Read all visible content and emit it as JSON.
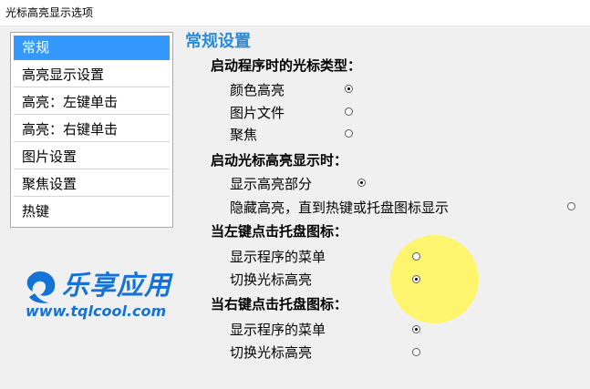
{
  "window": {
    "title": "光标高亮显示选项"
  },
  "sidebar": {
    "items": [
      {
        "label": "常规",
        "selected": true
      },
      {
        "label": "高亮显示设置",
        "selected": false
      },
      {
        "label": "高亮：左键单击",
        "selected": false
      },
      {
        "label": "高亮：右键单击",
        "selected": false
      },
      {
        "label": "图片设置",
        "selected": false
      },
      {
        "label": "聚焦设置",
        "selected": false
      },
      {
        "label": "热键",
        "selected": false
      }
    ]
  },
  "main": {
    "title": "常规设置",
    "groups": [
      {
        "title": "启动程序时的光标类型：",
        "options": [
          {
            "label": "颜色高亮",
            "checked": true
          },
          {
            "label": "图片文件",
            "checked": false
          },
          {
            "label": "聚焦",
            "checked": false
          }
        ]
      },
      {
        "title": "启动光标高亮显示时：",
        "options": [
          {
            "label": "显示高亮部分",
            "checked": true
          },
          {
            "label": "隐藏高亮，直到热键或托盘图标显示",
            "checked": false
          }
        ]
      },
      {
        "title": "当左键点击托盘图标：",
        "options": [
          {
            "label": "显示程序的菜单",
            "checked": false
          },
          {
            "label": "切换光标高亮",
            "checked": true
          }
        ]
      },
      {
        "title": "当右键点击托盘图标：",
        "options": [
          {
            "label": "显示程序的菜单",
            "checked": true
          },
          {
            "label": "切换光标高亮",
            "checked": false
          }
        ]
      }
    ]
  },
  "watermark": {
    "name": "乐享应用",
    "url": "www.tqlcool.com"
  },
  "colors": {
    "accent": "#3399ff",
    "title": "#2a8bd6",
    "highlight": "#fff550",
    "logo": "#1572d6"
  }
}
